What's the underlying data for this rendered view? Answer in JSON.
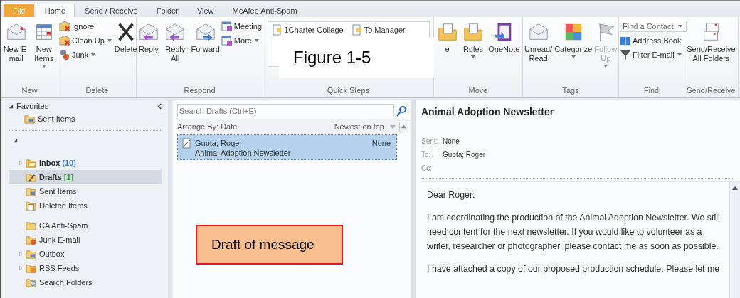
{
  "tabs": [
    {
      "label": "File",
      "kind": "file",
      "selected": false
    },
    {
      "label": "Home",
      "kind": "tab",
      "selected": true
    },
    {
      "label": "Send / Receive",
      "kind": "tab",
      "selected": false
    },
    {
      "label": "Folder",
      "kind": "tab",
      "selected": false
    },
    {
      "label": "View",
      "kind": "tab",
      "selected": false
    },
    {
      "label": "McAfee Anti-Spam",
      "kind": "tab",
      "selected": false
    }
  ],
  "ribbon": [
    {
      "name": "New",
      "columns": [
        {
          "kind": "large",
          "label": "New E-mail",
          "dropdown": false
        },
        {
          "kind": "large",
          "label": "New Items",
          "dropdown": true
        }
      ]
    },
    {
      "name": "Delete",
      "columns": [
        {
          "kind": "stack",
          "items": [
            {
              "label": "Ignore",
              "dropdown": false
            },
            {
              "label": "Clean Up",
              "dropdown": true
            },
            {
              "label": "Junk",
              "dropdown": true
            }
          ]
        },
        {
          "kind": "large",
          "label": "Delete",
          "dropdown": false
        }
      ]
    },
    {
      "name": "Respond",
      "columns": [
        {
          "kind": "large",
          "label": "Reply",
          "dropdown": false
        },
        {
          "kind": "large",
          "label": "Reply All",
          "dropdown": false
        },
        {
          "kind": "large",
          "label": "Forward",
          "dropdown": false
        },
        {
          "kind": "stack",
          "items": [
            {
              "label": "Meeting",
              "dropdown": false
            },
            {
              "label": "More",
              "dropdown": true
            }
          ]
        }
      ]
    },
    {
      "name": "Quick Steps",
      "columns": [
        {
          "kind": "quick",
          "items": [
            {
              "label": "1Charter College"
            },
            {
              "label": "To Manager"
            }
          ]
        }
      ]
    },
    {
      "name": "Move",
      "columns": [
        {
          "kind": "large",
          "label": "e",
          "dropdown": false
        },
        {
          "kind": "large",
          "label": "Rules",
          "dropdown": true
        },
        {
          "kind": "large",
          "label": "OneNote",
          "dropdown": false
        }
      ]
    },
    {
      "name": "Tags",
      "columns": [
        {
          "kind": "large",
          "label": "Unread/ Read",
          "dropdown": false
        },
        {
          "kind": "large",
          "label": "Categorize",
          "dropdown": true
        },
        {
          "kind": "large",
          "label": "Follow Up",
          "dropdown": true,
          "disabled": true
        }
      ]
    },
    {
      "name": "Find",
      "columns": [
        {
          "kind": "find",
          "field": "Find a Contact",
          "items": [
            {
              "label": "Address Book",
              "dropdown": false
            },
            {
              "label": "Filter E-mail",
              "dropdown": true
            }
          ]
        }
      ]
    },
    {
      "name": "Send/Receive",
      "columns": [
        {
          "kind": "large",
          "label": "Send/Receive All Folders",
          "dropdown": false
        }
      ]
    }
  ],
  "figure_label": "Figure 1-5",
  "nav": {
    "favorites": {
      "label": "Favorites",
      "expanded": true,
      "items": [
        {
          "label": "Sent Items",
          "selected": false
        }
      ]
    },
    "folders": [
      {
        "label": "Inbox",
        "count": "(10)",
        "color": "#3b7bd6",
        "bold": true,
        "expandable": true,
        "selected": false
      },
      {
        "label": "Drafts",
        "count": "[1]",
        "color": "#3a9a3a",
        "bold": true,
        "expandable": false,
        "selected": true
      },
      {
        "label": "Sent Items",
        "bold": false,
        "expandable": false,
        "selected": false
      },
      {
        "label": "Deleted Items",
        "bold": false,
        "expandable": false,
        "selected": false
      },
      {
        "label": "CA Anti-Spam",
        "bold": false,
        "expandable": false,
        "selected": false
      },
      {
        "label": "Junk E-mail",
        "bold": false,
        "expandable": false,
        "selected": false
      },
      {
        "label": "Outbox",
        "bold": false,
        "expandable": true,
        "selected": false
      },
      {
        "label": "RSS Feeds",
        "bold": false,
        "expandable": true,
        "selected": false
      },
      {
        "label": "Search Folders",
        "bold": false,
        "expandable": false,
        "selected": false
      }
    ]
  },
  "list": {
    "search_placeholder": "Search Drafts (Ctrl+E)",
    "arrange": "Arrange By: Date",
    "order": "Newest on top",
    "messages": [
      {
        "from": "Gupta; Roger",
        "subject": "Animal Adoption Newsletter",
        "date": "None",
        "selected": true
      }
    ]
  },
  "callout": "Draft of message",
  "reading": {
    "title": "Animal Adoption Newsletter",
    "fields": [
      {
        "label": "Sent:",
        "value": "None"
      },
      {
        "label": "To:",
        "value": "Gupta; Roger"
      },
      {
        "label": "Cc:"
      }
    ],
    "body": [
      "Dear Roger:",
      "I am coordinating the production of the Animal Adoption Newsletter. We still need content for the next newsletter. If you would like to volunteer as a writer, researcher or photographer, please contact me as soon as possible.",
      "I have attached a copy of our proposed production schedule. Please let me"
    ]
  }
}
